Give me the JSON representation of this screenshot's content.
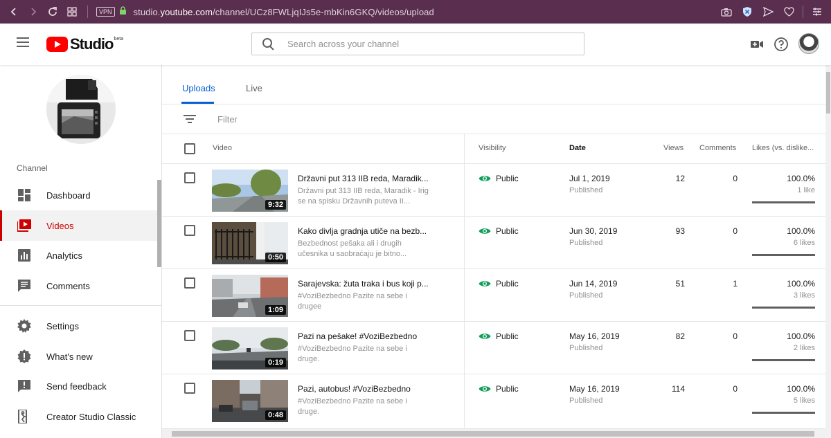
{
  "browser": {
    "url_prefix": "studio.",
    "url_domain": "youtube.com",
    "url_path": "/channel/UCz8FWLjqIJs5e-mbKin6GKQ/videos/upload",
    "vpn_label": "VPN"
  },
  "header": {
    "logo_text": "Studio",
    "beta_label": "beta",
    "search_placeholder": "Search across your channel"
  },
  "sidebar": {
    "channel_label": "Channel",
    "items": [
      {
        "label": "Dashboard",
        "icon": "dashboard-icon"
      },
      {
        "label": "Videos",
        "icon": "videos-icon",
        "active": true
      },
      {
        "label": "Analytics",
        "icon": "analytics-icon"
      },
      {
        "label": "Comments",
        "icon": "comments-icon"
      },
      {
        "label": "Settings",
        "icon": "gear-icon"
      },
      {
        "label": "What's new",
        "icon": "whats-new-icon"
      },
      {
        "label": "Send feedback",
        "icon": "feedback-icon"
      },
      {
        "label": "Creator Studio Classic",
        "icon": "classic-exit-icon"
      }
    ]
  },
  "tabs": [
    {
      "label": "Uploads",
      "active": true
    },
    {
      "label": "Live"
    }
  ],
  "filter": {
    "placeholder": "Filter"
  },
  "table": {
    "headers": {
      "video": "Video",
      "visibility": "Visibility",
      "date": "Date",
      "views": "Views",
      "comments": "Comments",
      "likes": "Likes (vs. dislike..."
    },
    "rows": [
      {
        "title": "Državni put 313 IIB reda, Maradik...",
        "description": "Državni put 313 IIB reda, Maradik - Irig se na spisku Državnih puteva II...",
        "duration": "9:32",
        "visibility": "Public",
        "date": "Jul 1, 2019",
        "status": "Published",
        "views": "12",
        "comments": "0",
        "likes_pct": "100.0%",
        "likes_count": "1 like",
        "like_ratio": 1.0
      },
      {
        "title": "Kako divlja gradnja utiče na bezb...",
        "description": "Bezbednost pešaka ali i drugih učesnika u saobraćaju je bitno...",
        "duration": "0:50",
        "visibility": "Public",
        "date": "Jun 30, 2019",
        "status": "Published",
        "views": "93",
        "comments": "0",
        "likes_pct": "100.0%",
        "likes_count": "6 likes",
        "like_ratio": 1.0
      },
      {
        "title": "Sarajevska: žuta traka i bus koji p...",
        "description": "#VoziBezbedno Pazite na sebe i drugee",
        "duration": "1:09",
        "visibility": "Public",
        "date": "Jun 14, 2019",
        "status": "Published",
        "views": "51",
        "comments": "1",
        "likes_pct": "100.0%",
        "likes_count": "3 likes",
        "like_ratio": 1.0
      },
      {
        "title": "Pazi na pešake! #VoziBezbedno",
        "description": "#VoziBezbedno Pazite na sebe i druge.",
        "duration": "0:19",
        "visibility": "Public",
        "date": "May 16, 2019",
        "status": "Published",
        "views": "82",
        "comments": "0",
        "likes_pct": "100.0%",
        "likes_count": "2 likes",
        "like_ratio": 1.0
      },
      {
        "title": "Pazi, autobus! #VoziBezbedno",
        "description": "#VoziBezbedno Pazite na sebe i druge.",
        "duration": "0:48",
        "visibility": "Public",
        "date": "May 16, 2019",
        "status": "Published",
        "views": "114",
        "comments": "0",
        "likes_pct": "100.0%",
        "likes_count": "5 likes",
        "like_ratio": 1.0
      }
    ]
  },
  "colors": {
    "browser_bar": "#5a2e4e",
    "brand_red": "#ff0000",
    "active_red": "#cc0000",
    "link_blue": "#065fd4",
    "public_green": "#0f9d58"
  }
}
